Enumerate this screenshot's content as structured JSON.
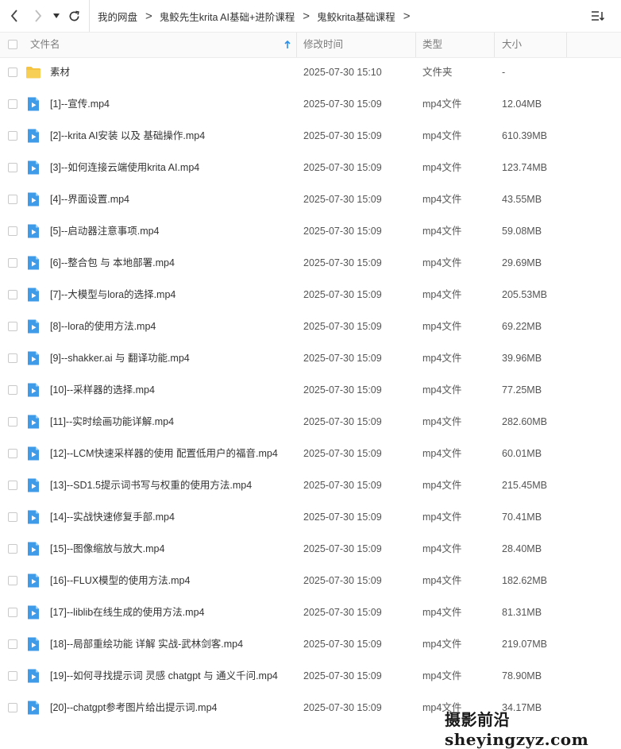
{
  "breadcrumb": [
    {
      "label": "我的网盘"
    },
    {
      "label": "鬼鲛先生krita AI基础+进阶课程"
    },
    {
      "label": "鬼鲛krita基础课程"
    }
  ],
  "columns": {
    "name": "文件名",
    "modified": "修改时间",
    "type": "类型",
    "size": "大小"
  },
  "colors": {
    "accent": "#2c8fe8",
    "folder": "#f6c443",
    "video_icon": "#3f9ae8"
  },
  "files": [
    {
      "kind": "folder",
      "name": "素材",
      "modified": "2025-07-30 15:10",
      "type": "文件夹",
      "size": "-"
    },
    {
      "kind": "video",
      "name": "[1]--宣传.mp4",
      "modified": "2025-07-30 15:09",
      "type": "mp4文件",
      "size": "12.04MB"
    },
    {
      "kind": "video",
      "name": "[2]--krita AI安装 以及 基础操作.mp4",
      "modified": "2025-07-30 15:09",
      "type": "mp4文件",
      "size": "610.39MB"
    },
    {
      "kind": "video",
      "name": "[3]--如何连接云端使用krita AI.mp4",
      "modified": "2025-07-30 15:09",
      "type": "mp4文件",
      "size": "123.74MB"
    },
    {
      "kind": "video",
      "name": "[4]--界面设置.mp4",
      "modified": "2025-07-30 15:09",
      "type": "mp4文件",
      "size": "43.55MB"
    },
    {
      "kind": "video",
      "name": "[5]--启动器注意事项.mp4",
      "modified": "2025-07-30 15:09",
      "type": "mp4文件",
      "size": "59.08MB"
    },
    {
      "kind": "video",
      "name": "[6]--整合包 与 本地部署.mp4",
      "modified": "2025-07-30 15:09",
      "type": "mp4文件",
      "size": "29.69MB"
    },
    {
      "kind": "video",
      "name": "[7]--大模型与lora的选择.mp4",
      "modified": "2025-07-30 15:09",
      "type": "mp4文件",
      "size": "205.53MB"
    },
    {
      "kind": "video",
      "name": "[8]--lora的使用方法.mp4",
      "modified": "2025-07-30 15:09",
      "type": "mp4文件",
      "size": "69.22MB"
    },
    {
      "kind": "video",
      "name": "[9]--shakker.ai 与 翻译功能.mp4",
      "modified": "2025-07-30 15:09",
      "type": "mp4文件",
      "size": "39.96MB"
    },
    {
      "kind": "video",
      "name": "[10]--采样器的选择.mp4",
      "modified": "2025-07-30 15:09",
      "type": "mp4文件",
      "size": "77.25MB"
    },
    {
      "kind": "video",
      "name": "[11]--实时绘画功能详解.mp4",
      "modified": "2025-07-30 15:09",
      "type": "mp4文件",
      "size": "282.60MB"
    },
    {
      "kind": "video",
      "name": "[12]--LCM快速采样器的使用 配置低用户的福音.mp4",
      "modified": "2025-07-30 15:09",
      "type": "mp4文件",
      "size": "60.01MB"
    },
    {
      "kind": "video",
      "name": "[13]--SD1.5提示词书写与权重的使用方法.mp4",
      "modified": "2025-07-30 15:09",
      "type": "mp4文件",
      "size": "215.45MB"
    },
    {
      "kind": "video",
      "name": "[14]--实战快速修复手部.mp4",
      "modified": "2025-07-30 15:09",
      "type": "mp4文件",
      "size": "70.41MB"
    },
    {
      "kind": "video",
      "name": "[15]--图像缩放与放大.mp4",
      "modified": "2025-07-30 15:09",
      "type": "mp4文件",
      "size": "28.40MB"
    },
    {
      "kind": "video",
      "name": "[16]--FLUX模型的使用方法.mp4",
      "modified": "2025-07-30 15:09",
      "type": "mp4文件",
      "size": "182.62MB"
    },
    {
      "kind": "video",
      "name": "[17]--liblib在线生成的使用方法.mp4",
      "modified": "2025-07-30 15:09",
      "type": "mp4文件",
      "size": "81.31MB"
    },
    {
      "kind": "video",
      "name": "[18]--局部重绘功能 详解 实战-武林剑客.mp4",
      "modified": "2025-07-30 15:09",
      "type": "mp4文件",
      "size": "219.07MB"
    },
    {
      "kind": "video",
      "name": "[19]--如何寻找提示词 灵感 chatgpt 与 通义千问.mp4",
      "modified": "2025-07-30 15:09",
      "type": "mp4文件",
      "size": "78.90MB"
    },
    {
      "kind": "video",
      "name": "[20]--chatgpt参考图片给出提示词.mp4",
      "modified": "2025-07-30 15:09",
      "type": "mp4文件",
      "size": "34.17MB"
    }
  ],
  "watermark": {
    "text": "摄影前沿 sheyingzyz.com"
  }
}
